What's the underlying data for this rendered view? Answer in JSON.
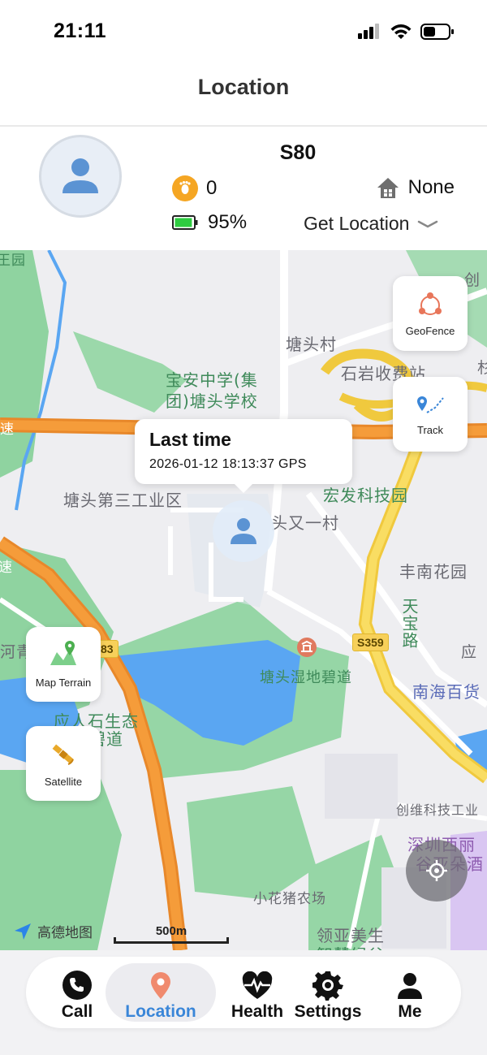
{
  "status_bar": {
    "time": "21:11"
  },
  "header": {
    "title": "Location"
  },
  "device": {
    "name": "S80",
    "steps": "0",
    "geofence_status": "None",
    "battery": "95%",
    "battery_level": 0.95,
    "get_location_label": "Get Location"
  },
  "map": {
    "callout": {
      "title": "Last time",
      "subtitle": "2026-01-12 18:13:37 GPS"
    },
    "buttons": {
      "geofence": "GeoFence",
      "track": "Track",
      "terrain": "Map Terrain",
      "satellite": "Satellite"
    },
    "labels": {
      "l1": "王园",
      "l2": "塘头村",
      "l3": "宝安中学(集",
      "l4": "团)塘头学校",
      "l5": "石岩收费站",
      "l6": "塘头第三工业区",
      "l7": "宏发科技园",
      "l8": "头又一村",
      "l9": "丰南花园",
      "l10": "天宝路",
      "l11": "塘头湿地碧道",
      "l12": "南海百货",
      "l13": "应人石生态",
      "l14": "碧道",
      "l15": "创维科技工业",
      "l16": "深圳西丽",
      "l17": "谷亚朵酒",
      "l18": "小花猪农场",
      "l19": "领亚美生",
      "l20": "智慧绿谷",
      "l21": "创",
      "l22": "速",
      "l23": "速",
      "l24": "河青",
      "l25": "应",
      "l26": "杉"
    },
    "road_badges": {
      "s359": "S359",
      "b83": "83"
    },
    "brand": "高德地图",
    "scale": "500m"
  },
  "tabs": [
    {
      "label": "Call",
      "icon": "phone-icon"
    },
    {
      "label": "Location",
      "icon": "location-pin-icon"
    },
    {
      "label": "Health",
      "icon": "heart-pulse-icon"
    },
    {
      "label": "Settings",
      "icon": "gear-icon"
    },
    {
      "label": "Me",
      "icon": "person-icon"
    }
  ],
  "colors": {
    "accent": "#3a86d8",
    "pin": "#f08a6e",
    "battery": "#2ecc40",
    "steps": "#f5a623"
  }
}
